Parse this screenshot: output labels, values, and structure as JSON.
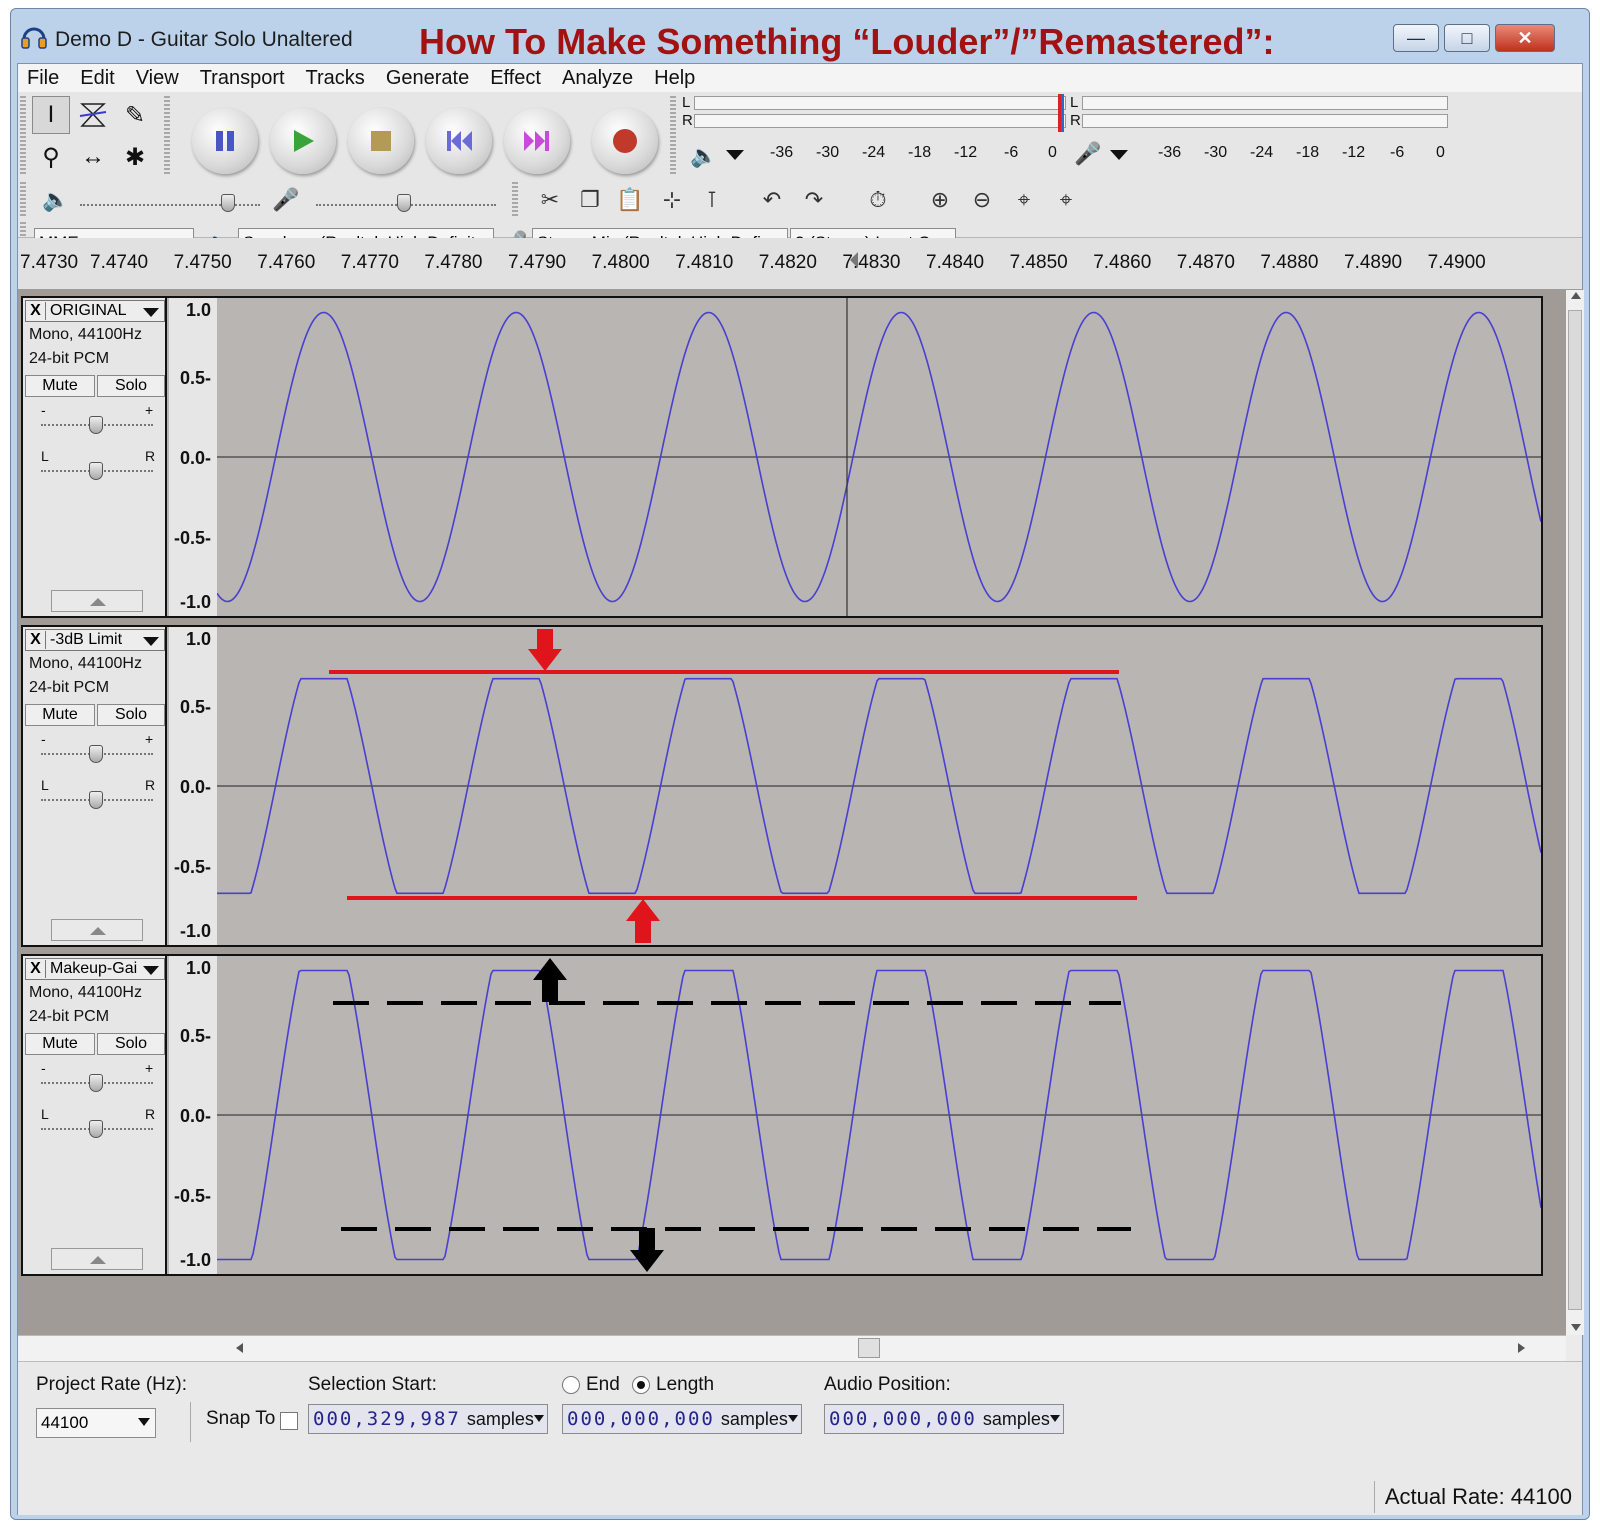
{
  "window": {
    "title": "Demo D - Guitar Solo Unaltered"
  },
  "overlay": {
    "title": "How To Make Something “Louder”/”Remastered”:"
  },
  "colors": {
    "waveform": "#4a3fd0",
    "track_bg": "#b8b5b2",
    "annotation_red": "#e0141b",
    "annotation_black": "#000000",
    "title_red": "#a31212"
  },
  "menu": [
    "File",
    "Edit",
    "View",
    "Transport",
    "Tracks",
    "Generate",
    "Effect",
    "Analyze",
    "Help"
  ],
  "tools": [
    "selection-tool-icon",
    "envelope-tool-icon",
    "draw-tool-icon",
    "zoom-tool-icon",
    "timeshift-tool-icon",
    "multi-tool-icon"
  ],
  "meters": {
    "play": {
      "l": "L",
      "r": "R",
      "ticks": [
        "-36",
        "-30",
        "-24",
        "-18",
        "-12",
        "-6",
        "0"
      ]
    },
    "record": {
      "l": "L",
      "r": "R",
      "ticks": [
        "-36",
        "-30",
        "-24",
        "-18",
        "-12",
        "-6",
        "0"
      ]
    }
  },
  "device": {
    "host": "MME",
    "output": "Speakers (Realtek High Definit",
    "input": "Stereo Mix (Realtek High Defir",
    "channels": "2 (Stereo) Input C"
  },
  "ruler": [
    "7.4730",
    "7.4740",
    "7.4750",
    "7.4760",
    "7.4770",
    "7.4780",
    "7.4790",
    "7.4800",
    "7.4810",
    "7.4820",
    "7.4830",
    "7.4840",
    "7.4850",
    "7.4860",
    "7.4870",
    "7.4880",
    "7.4890",
    "7.4900"
  ],
  "vruler": [
    "1.0",
    "0.5-",
    "0.0-",
    "-0.5-",
    "-1.0"
  ],
  "tracks": [
    {
      "name": "ORIGINAL",
      "info1": "Mono, 44100Hz",
      "info2": "24-bit PCM",
      "mute": "Mute",
      "solo": "Solo",
      "gain_minus": "-",
      "gain_plus": "+",
      "pan_l": "L",
      "pan_r": "R",
      "clip_level": 1.0
    },
    {
      "name": "-3dB Limit",
      "info1": "Mono, 44100Hz",
      "info2": "24-bit PCM",
      "mute": "Mute",
      "solo": "Solo",
      "gain_minus": "-",
      "gain_plus": "+",
      "pan_l": "L",
      "pan_r": "R",
      "clip_level": 0.72
    },
    {
      "name": "Makeup-Gai",
      "info1": "Mono, 44100Hz",
      "info2": "24-bit PCM",
      "mute": "Mute",
      "solo": "Solo",
      "gain_minus": "-",
      "gain_plus": "+",
      "pan_l": "L",
      "pan_r": "R",
      "clip_level": 1.0
    }
  ],
  "selection": {
    "project_rate_label": "Project Rate (Hz):",
    "project_rate": "44100",
    "snap_to": "Snap To",
    "start_label": "Selection Start:",
    "end_label": "End",
    "length_label": "Length",
    "start_value": "000,329,987",
    "length_value": "000,000,000",
    "unit": "samples",
    "audio_position_label": "Audio Position:",
    "audio_position_value": "000,000,000"
  },
  "status": {
    "actual_rate": "Actual Rate: 44100"
  }
}
